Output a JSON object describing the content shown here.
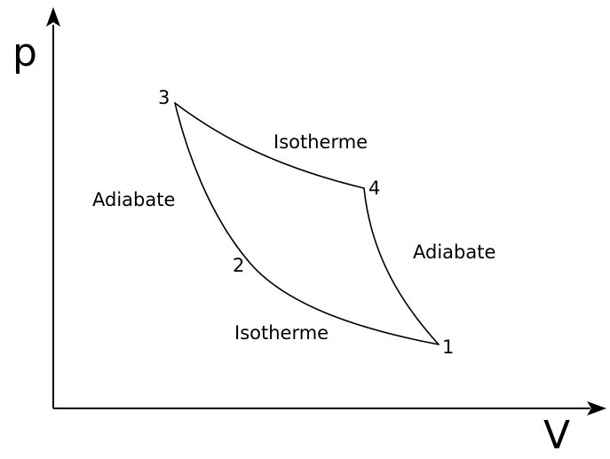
{
  "diagram": {
    "axes": {
      "y_label": "p",
      "x_label": "V"
    },
    "points": [
      {
        "id": "1",
        "label": "1"
      },
      {
        "id": "2",
        "label": "2"
      },
      {
        "id": "3",
        "label": "3"
      },
      {
        "id": "4",
        "label": "4"
      }
    ],
    "processes": {
      "isotherm_hot": "Isotherme",
      "isotherm_cold": "Isotherme",
      "adiabat_left": "Adiabate",
      "adiabat_right": "Adiabate"
    },
    "colors": {
      "stroke": "#000000",
      "background": "#ffffff"
    }
  }
}
